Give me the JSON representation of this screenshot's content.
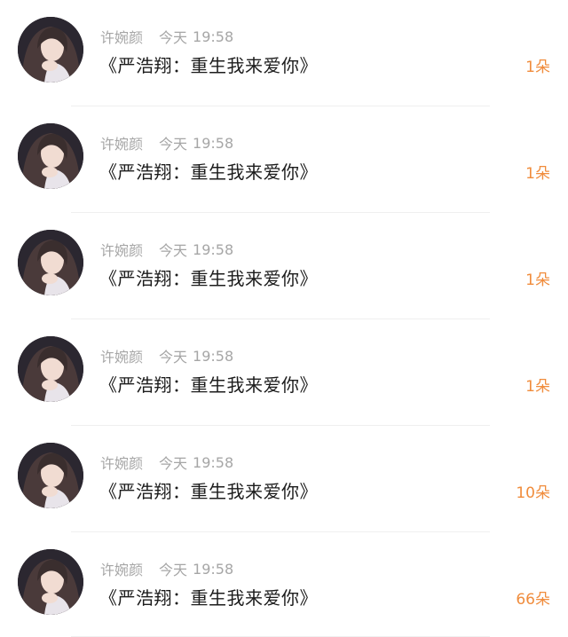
{
  "list": {
    "items": [
      {
        "name": "许婉颜",
        "day": "今天",
        "time": "19:58",
        "title": "《严浩翔：重生我来爱你》",
        "count": "1朵"
      },
      {
        "name": "许婉颜",
        "day": "今天",
        "time": "19:58",
        "title": "《严浩翔：重生我来爱你》",
        "count": "1朵"
      },
      {
        "name": "许婉颜",
        "day": "今天",
        "time": "19:58",
        "title": "《严浩翔：重生我来爱你》",
        "count": "1朵"
      },
      {
        "name": "许婉颜",
        "day": "今天",
        "time": "19:58",
        "title": "《严浩翔：重生我来爱你》",
        "count": "1朵"
      },
      {
        "name": "许婉颜",
        "day": "今天",
        "time": "19:58",
        "title": "《严浩翔：重生我来爱你》",
        "count": "10朵"
      },
      {
        "name": "许婉颜",
        "day": "今天",
        "time": "19:58",
        "title": "《严浩翔：重生我来爱你》",
        "count": "66朵"
      }
    ]
  },
  "colors": {
    "background": "#ffffff",
    "meta_text": "#a6a6a6",
    "title_text": "#1c1c1c",
    "count_accent": "#f08c3c",
    "divider": "#efefef"
  },
  "icons": {
    "avatar": "user-avatar-photo"
  }
}
